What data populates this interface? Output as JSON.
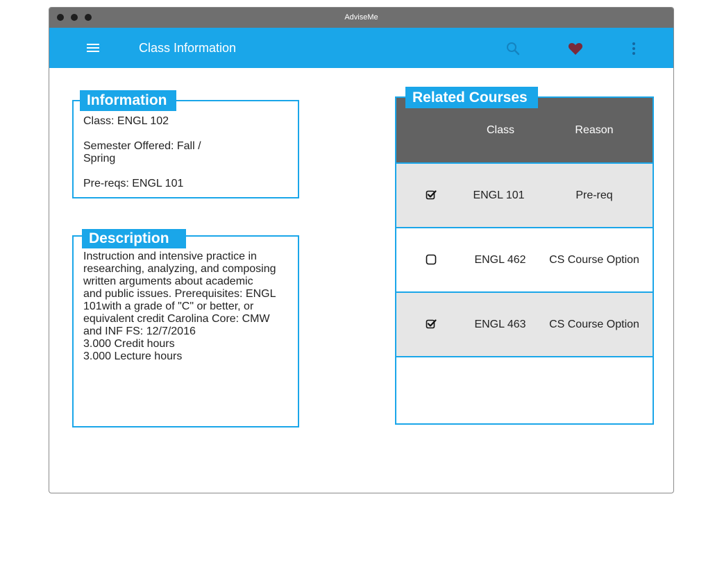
{
  "window": {
    "title": "AdviseMe"
  },
  "appbar": {
    "title": "Class Information"
  },
  "information": {
    "heading": "Information",
    "lines": [
      "Class: ENGL 102",
      "Semester Offered: Fall /",
      "Spring",
      "Pre-reqs: ENGL 101"
    ]
  },
  "description": {
    "heading": "Description",
    "lines": [
      "Instruction and intensive practice in",
      "researching, analyzing, and composing",
      "written arguments about academic",
      "and public issues. Prerequisites: ENGL",
      "101with a grade of \"C\" or better, or",
      "equivalent credit Carolina Core: CMW",
      "and INF FS: 12/7/2016",
      "3.000 Credit hours",
      "3.000 Lecture hours"
    ]
  },
  "related": {
    "heading": "Related Courses",
    "columns": [
      "Class",
      "Reason"
    ],
    "rows": [
      {
        "checked": true,
        "class": "ENGL 101",
        "reason": "Pre-req",
        "bg": "#e6e6e6"
      },
      {
        "checked": false,
        "class": "ENGL 462",
        "reason": "CS Course Option",
        "bg": "#ffffff"
      },
      {
        "checked": true,
        "class": "ENGL 463",
        "reason": "CS Course Option",
        "bg": "#e6e6e6"
      }
    ]
  },
  "colors": {
    "accent": "#1aa6e9",
    "header": "#626262",
    "titlebar": "#6f6f6f"
  },
  "icons": [
    "menu-icon",
    "search-icon",
    "heart-icon",
    "more-vert-icon"
  ]
}
